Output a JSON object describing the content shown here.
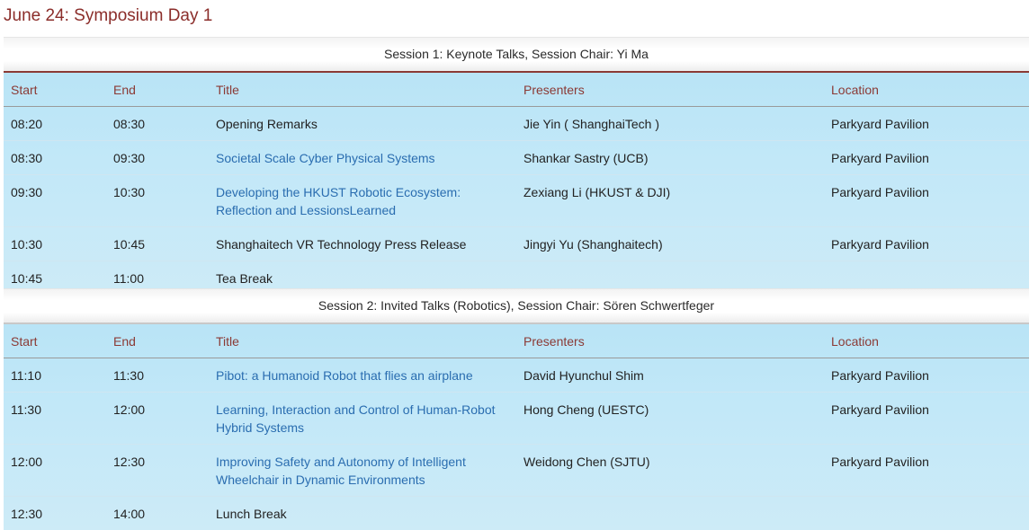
{
  "page": {
    "title": "June 24: Symposium Day 1"
  },
  "headers": {
    "start": "Start",
    "end": "End",
    "title": "Title",
    "presenters": "Presenters",
    "location": "Location"
  },
  "sessions": [
    {
      "label": "Session 1: Keynote Talks, Session Chair: Yi Ma",
      "rows": [
        {
          "start": "08:20",
          "end": "08:30",
          "title": "Opening Remarks",
          "link": false,
          "presenters": "Jie Yin ( ShanghaiTech )",
          "location": "Parkyard Pavilion"
        },
        {
          "start": "08:30",
          "end": "09:30",
          "title": "Societal Scale Cyber Physical Systems",
          "link": true,
          "presenters": "Shankar Sastry (UCB)",
          "location": "Parkyard Pavilion"
        },
        {
          "start": "09:30",
          "end": "10:30",
          "title": "Developing the HKUST Robotic Ecosystem: Reflection and LessionsLearned",
          "link": true,
          "presenters": "Zexiang Li (HKUST & DJI)",
          "location": "Parkyard Pavilion"
        },
        {
          "start": "10:30",
          "end": "10:45",
          "title": "Shanghaitech VR Technology Press Release",
          "link": false,
          "presenters": "Jingyi Yu (Shanghaitech)",
          "location": "Parkyard Pavilion"
        },
        {
          "start": "10:45",
          "end": "11:00",
          "title": "Tea Break",
          "link": false,
          "presenters": "",
          "location": ""
        }
      ]
    },
    {
      "label": "Session 2: Invited Talks (Robotics), Session Chair: Sören Schwertfeger",
      "rows": [
        {
          "start": "11:10",
          "end": "11:30",
          "title": "Pibot: a Humanoid Robot that flies an airplane",
          "link": true,
          "presenters": "David Hyunchul Shim",
          "location": "Parkyard Pavilion"
        },
        {
          "start": "11:30",
          "end": "12:00",
          "title": "Learning, Interaction and Control of Human-Robot Hybrid Systems",
          "link": true,
          "presenters": "Hong Cheng (UESTC)",
          "location": "Parkyard Pavilion"
        },
        {
          "start": "12:00",
          "end": "12:30",
          "title": "Improving Safety and Autonomy of Intelligent Wheelchair in Dynamic Environments",
          "link": true,
          "presenters": "Weidong Chen (SJTU)",
          "location": "Parkyard Pavilion"
        },
        {
          "start": "12:30",
          "end": "14:00",
          "title": "Lunch Break",
          "link": false,
          "presenters": "",
          "location": ""
        }
      ]
    }
  ],
  "colors": {
    "title": "#8b2d2a",
    "header_text": "#8b3a35",
    "link": "#2a6db0",
    "table_bg": "#c2e8f8"
  }
}
